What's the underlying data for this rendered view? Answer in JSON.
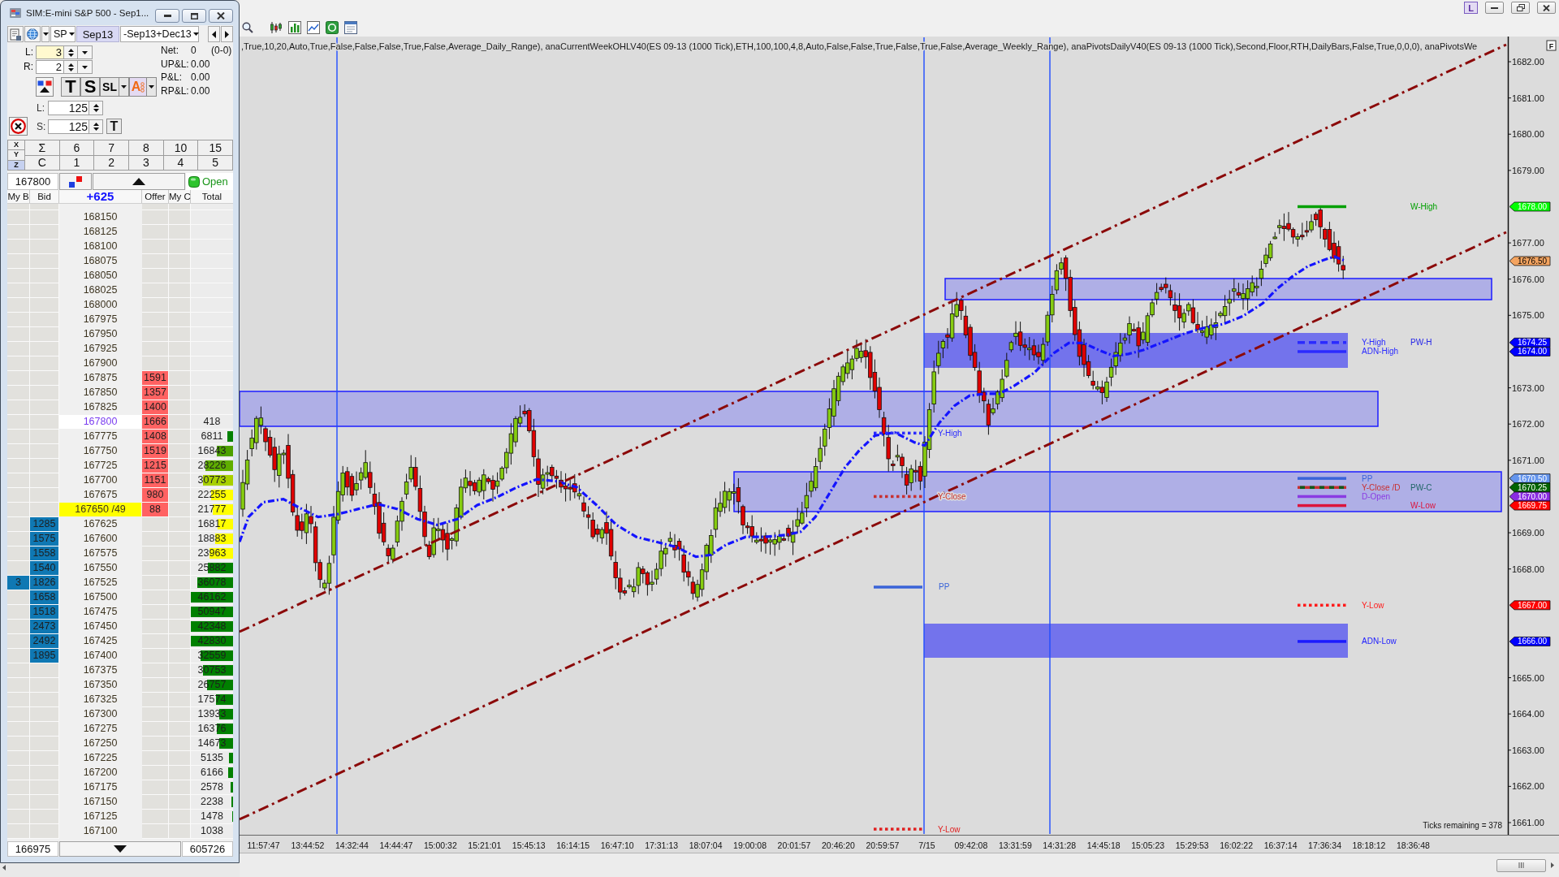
{
  "dom_window": {
    "title": "SIM:E-mini S&P 500 - Sep1...",
    "instrument": "SP",
    "contract": "Sep13",
    "spread": "-Sep13+Dec13",
    "quantities": [
      {
        "label": "L:",
        "value": "3",
        "focused": true
      },
      {
        "label": "R:",
        "value": "2",
        "focused": false
      }
    ],
    "account": [
      {
        "label": "Net:",
        "value": "0",
        "detail": "(0-0)"
      },
      {
        "label": "UP&L:",
        "value": "0.00"
      },
      {
        "label": "P&L:",
        "value": "0.00"
      },
      {
        "label": "RP&L:",
        "value": "0.00"
      }
    ],
    "order_buttons": [
      {
        "kind": "large",
        "label": "T",
        "dropdown": false
      },
      {
        "kind": "large",
        "label": "S",
        "dropdown": false
      },
      {
        "kind": "small",
        "label": "SL",
        "dropdown": true
      },
      {
        "kind": "auto",
        "label": "A",
        "dropdown": true
      }
    ],
    "brackets": [
      {
        "label": "L:",
        "value": "125"
      },
      {
        "label": "S:",
        "value": "125"
      }
    ],
    "bracket_button": "T",
    "quantity_grid": {
      "axes": [
        {
          "label": "X",
          "selected": false
        },
        {
          "label": "Y",
          "selected": false
        },
        {
          "label": "Z",
          "selected": true
        }
      ],
      "rows": [
        [
          "Σ",
          "6",
          "7",
          "8",
          "10",
          "15"
        ],
        [
          "C",
          "1",
          "2",
          "3",
          "4",
          "5"
        ]
      ]
    },
    "price_entry": "167800",
    "session": {
      "label": "Open",
      "on": true
    },
    "ladder": {
      "columns": [
        {
          "kind": "header",
          "label": "My B"
        },
        {
          "kind": "header",
          "label": "Bid"
        },
        {
          "kind": "change",
          "label": "+625"
        },
        {
          "kind": "header",
          "label": "Offer"
        },
        {
          "kind": "header",
          "label": "My C"
        },
        {
          "kind": "header",
          "label": "Total"
        }
      ],
      "rows": [
        {
          "price": "168150",
          "last": false,
          "inside": false
        },
        {
          "price": "168125",
          "last": false,
          "inside": false
        },
        {
          "price": "168100",
          "last": false,
          "inside": false
        },
        {
          "price": "168075",
          "last": false,
          "inside": false
        },
        {
          "price": "168050",
          "last": false,
          "inside": false
        },
        {
          "price": "168025",
          "last": false,
          "inside": false
        },
        {
          "price": "168000",
          "last": false,
          "inside": false
        },
        {
          "price": "167975",
          "last": false,
          "inside": false
        },
        {
          "price": "167950",
          "last": false,
          "inside": false
        },
        {
          "price": "167925",
          "last": false,
          "inside": false
        },
        {
          "price": "167900",
          "last": false,
          "inside": false
        },
        {
          "price": "167875",
          "offer": "1591",
          "last": false,
          "inside": false
        },
        {
          "price": "167850",
          "offer": "1357",
          "last": false,
          "inside": false
        },
        {
          "price": "167825",
          "offer": "1400",
          "last": false,
          "inside": false
        },
        {
          "price": "167800",
          "offer": "1666",
          "total": "418",
          "last": true,
          "inside": false
        },
        {
          "price": "167775",
          "offer": "1408",
          "total": "6811",
          "level": 0.14,
          "color": "#008000",
          "last": false,
          "inside": false
        },
        {
          "price": "167750",
          "offer": "1519",
          "total": "16843",
          "level": 0.38,
          "color": "#4ca000",
          "last": false,
          "inside": false
        },
        {
          "price": "167725",
          "offer": "1215",
          "total": "28226",
          "level": 0.65,
          "color": "#5fae00",
          "last": false,
          "inside": false
        },
        {
          "price": "167700",
          "offer": "1151",
          "total": "30773",
          "level": 0.72,
          "color": "#a8d000",
          "last": false,
          "inside": false
        },
        {
          "price": "167675",
          "offer": "980",
          "total": "22255",
          "level": 0.51,
          "color": "#ffff00",
          "last": false,
          "inside": false
        },
        {
          "price": "167650 /49",
          "offer": "88",
          "total": "21777",
          "level": 0.49,
          "color": "#ffff00",
          "last": false,
          "inside": true
        },
        {
          "price": "167625",
          "bid": "1285",
          "total": "16817",
          "level": 0.37,
          "color": "#ffff00",
          "last": false,
          "inside": false
        },
        {
          "price": "167600",
          "bid": "1575",
          "total": "18883",
          "level": 0.43,
          "color": "#ffff00",
          "last": false,
          "inside": false
        },
        {
          "price": "167575",
          "bid": "1558",
          "total": "23963",
          "level": 0.56,
          "color": "#ffff00",
          "last": false,
          "inside": false
        },
        {
          "price": "167550",
          "bid": "1540",
          "total": "25882",
          "level": 0.59,
          "color": "#008000",
          "last": false,
          "inside": false
        },
        {
          "price": "167525",
          "my_bid": "3",
          "bid": "1826",
          "total": "36078",
          "level": 0.85,
          "color": "#008000",
          "last": false,
          "inside": false
        },
        {
          "price": "167500",
          "bid": "1658",
          "total": "46162",
          "level": 1,
          "color": "#008000",
          "last": false,
          "inside": false
        },
        {
          "price": "167475",
          "bid": "1518",
          "total": "50947",
          "level": 1,
          "color": "#008000",
          "last": false,
          "inside": false
        },
        {
          "price": "167450",
          "bid": "2473",
          "total": "42348",
          "level": 1,
          "color": "#008000",
          "last": false,
          "inside": false
        },
        {
          "price": "167425",
          "bid": "2492",
          "total": "42830",
          "level": 1,
          "color": "#008000",
          "last": false,
          "inside": false
        },
        {
          "price": "167400",
          "bid": "1895",
          "total": "32559",
          "level": 0.76,
          "color": "#008000",
          "last": false,
          "inside": false
        },
        {
          "price": "167375",
          "total": "30753",
          "level": 0.71,
          "color": "#008000",
          "last": false,
          "inside": false
        },
        {
          "price": "167350",
          "total": "26757",
          "level": 0.61,
          "color": "#008000",
          "last": false,
          "inside": false
        },
        {
          "price": "167325",
          "total": "17574",
          "level": 0.4,
          "color": "#008000",
          "last": false,
          "inside": false
        },
        {
          "price": "167300",
          "total": "13933",
          "level": 0.32,
          "color": "#008000",
          "last": false,
          "inside": false
        },
        {
          "price": "167275",
          "total": "16376",
          "level": 0.38,
          "color": "#008000",
          "last": false,
          "inside": false
        },
        {
          "price": "167250",
          "total": "14673",
          "level": 0.32,
          "color": "#008000",
          "last": false,
          "inside": false
        },
        {
          "price": "167225",
          "total": "5135",
          "level": 0.1,
          "color": "#008000",
          "last": false,
          "inside": false
        },
        {
          "price": "167200",
          "total": "6166",
          "level": 0.12,
          "color": "#008000",
          "last": false,
          "inside": false
        },
        {
          "price": "167175",
          "total": "2578",
          "level": 0.05,
          "color": "#008000",
          "last": false,
          "inside": false
        },
        {
          "price": "167150",
          "total": "2238",
          "level": 0.03,
          "color": "#008000",
          "last": false,
          "inside": false
        },
        {
          "price": "167125",
          "total": "1478",
          "level": 0.02,
          "color": "#008000",
          "last": false,
          "inside": false
        },
        {
          "price": "167100",
          "total": "1038",
          "last": false,
          "inside": false
        }
      ],
      "footer": {
        "low": "166975",
        "total": "605726"
      }
    }
  },
  "chart": {
    "link_button": "L",
    "indicators": ",True,10,20,Auto,True,False,False,False,True,False,Average_Daily_Range), anaCurrentWeekOHLV40(ES 09-13 (1000 Tick),ETH,100,100,4,8,Auto,False,False,True,False,True,False,Average_Weekly_Range), anaPivotsDailyV40(ES 09-13 (1000 Tick),Second,Floor,RTH,DailyBars,False,True,0,0,0), anaPivotsWe",
    "corner_button": "F",
    "levels": [
      {
        "label": "W-High",
        "color": "#00a000",
        "kind": "solid"
      },
      {
        "label": "Y-High",
        "color": "#2a2aff",
        "kind": "dashed"
      },
      {
        "label": "ADN-High",
        "color": "#2a2aff",
        "kind": "solid"
      },
      {
        "label": "PW-H",
        "color": "#2424e8",
        "kind": "label"
      },
      {
        "label": "PP",
        "color": "#3a64d8",
        "kind": "solid"
      },
      {
        "label": "Y-Close /D",
        "color": "#c83030",
        "kind": "bicolor"
      },
      {
        "label": "PW-C",
        "color": "#1e6464",
        "kind": "label"
      },
      {
        "label": "D-Open",
        "color": "#8a3be2",
        "kind": "solid"
      },
      {
        "label": "W-Low",
        "color": "#dc143c",
        "kind": "solid"
      },
      {
        "label": "Y-Low",
        "color": "#ff1a1a",
        "kind": "dotted"
      },
      {
        "label": "ADN-Low",
        "color": "#1a1aff",
        "kind": "solid"
      },
      {
        "label": "Y-High",
        "color": "#2a2aff",
        "kind": "dotted"
      },
      {
        "label": "Y-Close",
        "color": "#c83030",
        "kind": "dotted"
      },
      {
        "label": "PP",
        "color": "#3a64d8",
        "kind": "solid"
      },
      {
        "label": "Y-Low",
        "color": "#e02020",
        "kind": "dotted"
      }
    ],
    "price_axis": [
      "1682.00",
      "1681.00",
      "1680.00",
      "1679.00",
      "1677.00",
      "1676.00",
      "1675.00",
      "1673.00",
      "1672.00",
      "1671.00",
      "1669.00",
      "1668.00",
      "1665.00",
      "1664.00",
      "1663.00",
      "1662.00",
      "1661.00"
    ],
    "price_markers": [
      {
        "value": "1678.00",
        "color": "#00ff00"
      },
      {
        "value": "1676.50",
        "color": "#f4a460"
      },
      {
        "value": "1674.25",
        "color": "#0000ff"
      },
      {
        "value": "1674.00",
        "color": "#0000ff"
      },
      {
        "value": "1670.50",
        "color": "#6495ed"
      },
      {
        "value": "1670.25",
        "color": "#006400"
      },
      {
        "value": "1670.00",
        "color": "#8a2be2"
      },
      {
        "value": "1669.75",
        "color": "#ff0000"
      },
      {
        "value": "1667.00",
        "color": "#ff0000"
      },
      {
        "value": "1666.00",
        "color": "#0000ff"
      }
    ],
    "time_axis": [
      "11:57:47",
      "13:44:52",
      "14:32:44",
      "14:44:47",
      "15:00:32",
      "15:21:01",
      "15:45:13",
      "16:14:15",
      "16:47:10",
      "17:31:13",
      "18:07:04",
      "19:00:08",
      "20:01:57",
      "20:46:20",
      "20:59:57",
      "7/15",
      "09:42:08",
      "13:31:59",
      "14:31:28",
      "14:45:18",
      "15:05:23",
      "15:29:53",
      "16:02:22",
      "16:37:14",
      "17:36:34",
      "18:18:12",
      "18:36:48"
    ],
    "ticks_remaining": "Ticks remaining = 378"
  }
}
